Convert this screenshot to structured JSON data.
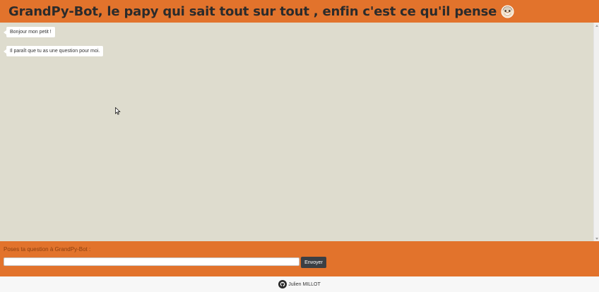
{
  "header": {
    "title": "GrandPy-Bot, le papy qui sait tout sur tout , enfin c'est ce qu'il pense",
    "icon": "papy-face-icon",
    "background": "#e2732c"
  },
  "chat": {
    "background": "#dedcce",
    "messages": [
      {
        "text": "Bonjour mon petit !"
      },
      {
        "text": "Il paraît que tu as une question pour moi."
      }
    ]
  },
  "question_form": {
    "label": "Poses ta question à GrandPy-Bot :",
    "input_value": "",
    "send_label": "Envoyer"
  },
  "footer": {
    "icon": "github-icon",
    "author": "Julien MILLOT"
  }
}
